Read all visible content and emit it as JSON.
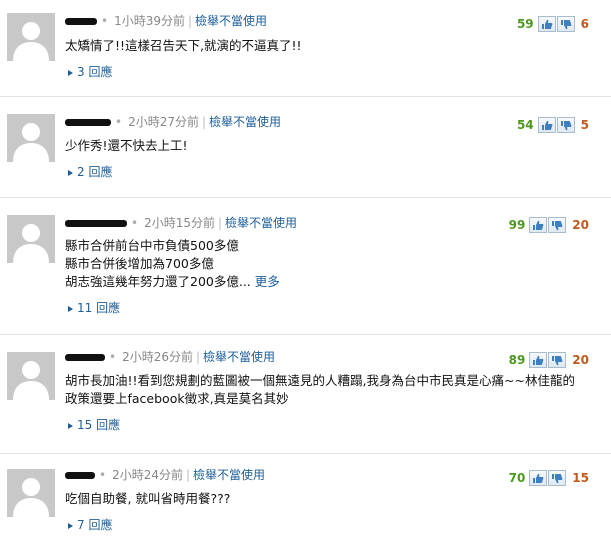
{
  "labels": {
    "report": "檢舉不當使用",
    "replies_suffix": "回應",
    "more": "更多"
  },
  "icons": {
    "avatar": "default-user-avatar",
    "thumb_up": "thumb-up-icon",
    "thumb_down": "thumb-down-icon",
    "replies": "triangle-right-icon"
  },
  "colors": {
    "link": "#1d5f9a",
    "up_count": "#4a9a1a",
    "down_count": "#c4591d"
  },
  "comments": [
    {
      "time": "1小時39分前",
      "text_lines": [
        "太矯情了!!這樣召告天下,就演的不逼真了!!"
      ],
      "replies": "3",
      "up": "59",
      "down": "6"
    },
    {
      "time": "2小時27分前",
      "text_lines": [
        "少作秀!還不快去上工!"
      ],
      "replies": "2",
      "up": "54",
      "down": "5"
    },
    {
      "time": "2小時15分前",
      "text_lines": [
        "縣市合併前台中市負債500多億",
        "縣市合併後增加為700多億",
        "胡志強這幾年努力還了200多億..."
      ],
      "replies": "11",
      "up": "99",
      "down": "20"
    },
    {
      "time": "2小時26分前",
      "text_lines": [
        "胡市長加油!!看到您規劃的藍圖被一個無遠見的人糟蹋,我身為台中市民真是心痛~~林佳龍的",
        "政策還要上facebook徵求,真是莫名其妙"
      ],
      "replies": "15",
      "up": "89",
      "down": "20"
    },
    {
      "time": "2小時24分前",
      "text_lines": [
        "吃個自助餐, 就叫省時用餐???"
      ],
      "replies": "7",
      "up": "70",
      "down": "15"
    }
  ]
}
